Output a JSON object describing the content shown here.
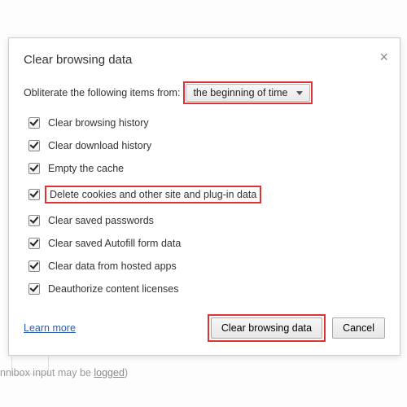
{
  "dialog": {
    "title": "Clear browsing data",
    "close": "×",
    "obliterate_label": "Obliterate the following items from:",
    "time_range": "the beginning of time",
    "checkboxes": [
      {
        "label": "Clear browsing history",
        "highlight": false
      },
      {
        "label": "Clear download history",
        "highlight": false
      },
      {
        "label": "Empty the cache",
        "highlight": false
      },
      {
        "label": "Delete cookies and other site and plug-in data",
        "highlight": true
      },
      {
        "label": "Clear saved passwords",
        "highlight": false
      },
      {
        "label": "Clear saved Autofill form data",
        "highlight": false
      },
      {
        "label": "Clear data from hosted apps",
        "highlight": false
      },
      {
        "label": "Deauthorize content licenses",
        "highlight": false
      }
    ],
    "learn_more": "Learn more",
    "clear_button": "Clear browsing data",
    "cancel_button": "Cancel"
  },
  "background": {
    "omnibox_text_a": "nnibox input may be ",
    "omnibox_text_b": "logged",
    "omnibox_text_c": ")"
  }
}
